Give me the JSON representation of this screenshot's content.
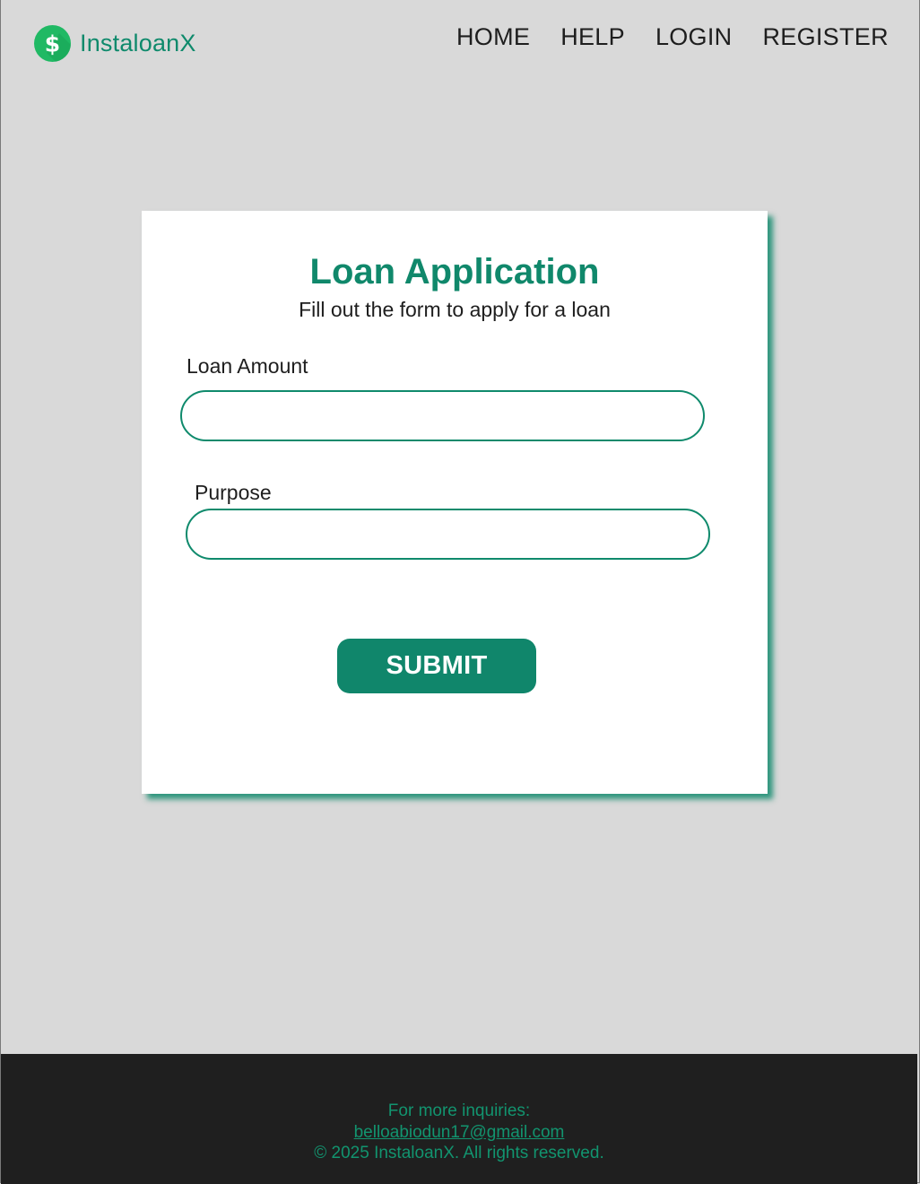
{
  "header": {
    "logo_text": "InstaloanX",
    "logo_icon": "dollar-coin-icon",
    "nav": [
      {
        "label": "HOME"
      },
      {
        "label": "HELP"
      },
      {
        "label": "LOGIN"
      },
      {
        "label": "REGISTER"
      }
    ]
  },
  "form": {
    "title": "Loan Application",
    "subtitle": "Fill out the form to apply for a loan",
    "fields": [
      {
        "label": "Loan Amount",
        "value": ""
      },
      {
        "label": "Purpose",
        "value": ""
      }
    ],
    "submit_label": "SUBMIT"
  },
  "footer": {
    "inquiries_text": "For more inquiries:",
    "email": "belloabiodun17@gmail.com",
    "copyright": "© 2025 InstaloanX. All rights reserved."
  },
  "colors": {
    "brand": "#10886b",
    "logo_coin": "#20b964",
    "background": "#d9d9d9",
    "footer_bg": "#1f1f1f"
  }
}
